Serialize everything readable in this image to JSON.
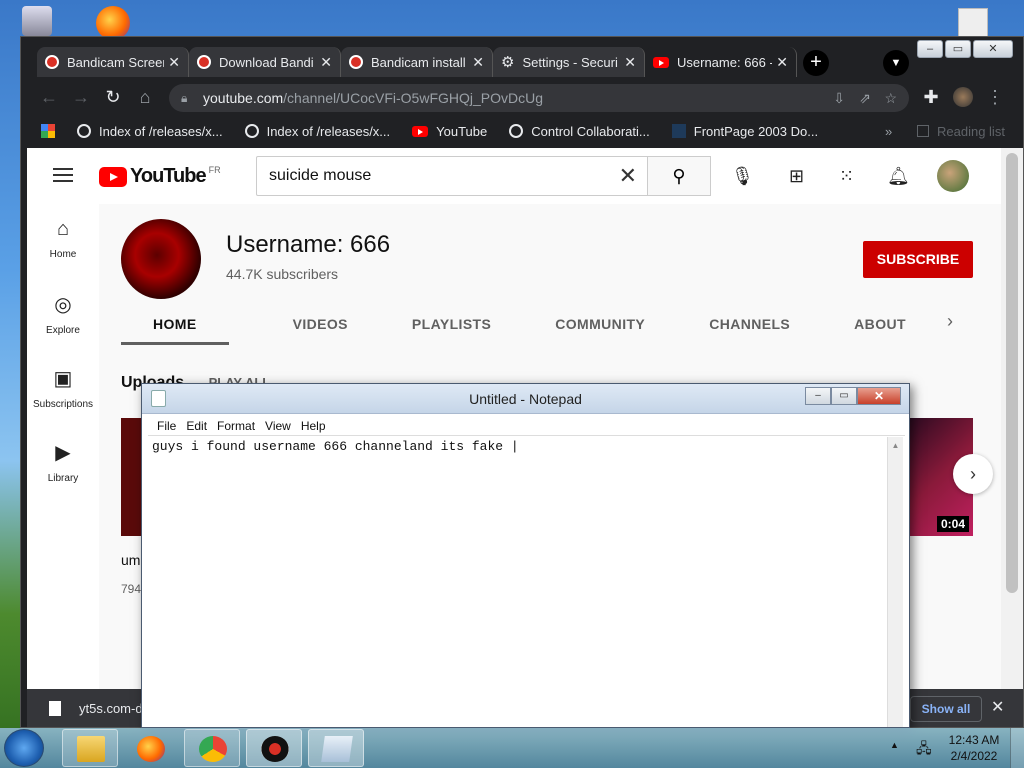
{
  "chrome": {
    "tabs": [
      {
        "label": "Bandicam Screen",
        "icon": "bandicam-icon"
      },
      {
        "label": "Download Bandi",
        "icon": "bandicam-icon"
      },
      {
        "label": "Bandicam install",
        "icon": "bandicam-icon"
      },
      {
        "label": "Settings - Securi",
        "icon": "gear-icon"
      },
      {
        "label": "Username: 666 -",
        "icon": "youtube-icon"
      }
    ],
    "new_tab": "+",
    "url_domain": "youtube.com",
    "url_path": "/channel/UCocVFi-O5wFGHQj_POvDcUg",
    "bookmarks": [
      "Index of /releases/x...",
      "Index of /releases/x...",
      "YouTube",
      "Control Collaborati...",
      "FrontPage 2003 Do..."
    ],
    "reading_list": "Reading list"
  },
  "youtube": {
    "logo_text": "YouTube",
    "region": "FR",
    "search_value": "suicide mouse",
    "sidebar": [
      {
        "label": "Home",
        "icon": "home-icon"
      },
      {
        "label": "Explore",
        "icon": "compass-icon"
      },
      {
        "label": "Subscriptions",
        "icon": "subscriptions-icon"
      },
      {
        "label": "Library",
        "icon": "library-icon"
      }
    ],
    "channel_name": "Username: 666",
    "subscribers": "44.7K subscribers",
    "subscribe_label": "SUBSCRIBE",
    "tabs": [
      "HOME",
      "VIDEOS",
      "PLAYLISTS",
      "COMMUNITY",
      "CHANNELS",
      "ABOUT"
    ],
    "uploads_label": "Uploads",
    "play_all": "PLAY ALL",
    "video_title_partial": "um",
    "video_views_partial": "794",
    "video_duration": "0:04"
  },
  "download_bar": {
    "file": "yt5s.com-de",
    "show_all": "Show all"
  },
  "notepad": {
    "title": "Untitled - Notepad",
    "menu": [
      "File",
      "Edit",
      "Format",
      "View",
      "Help"
    ],
    "content": "guys i found username 666 channeland its fake |"
  },
  "taskbar": {
    "time": "12:43 AM",
    "date": "2/4/2022"
  }
}
